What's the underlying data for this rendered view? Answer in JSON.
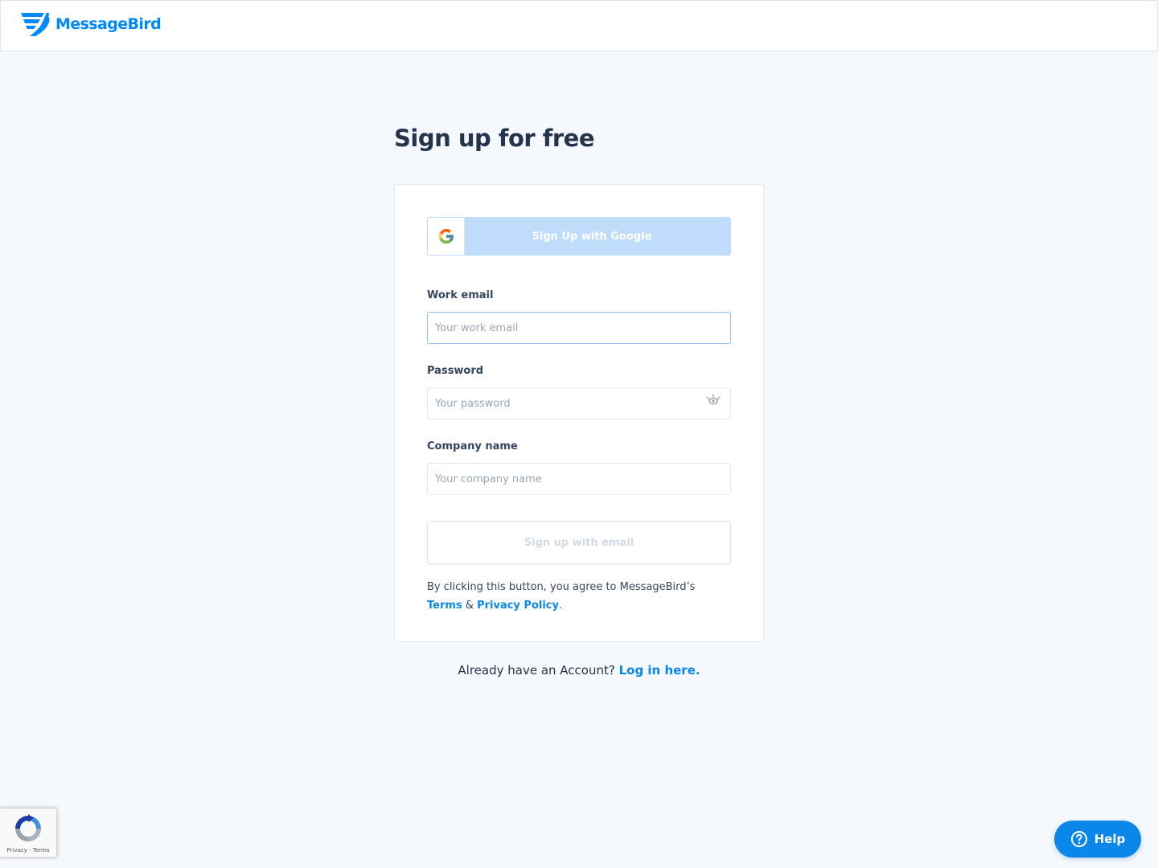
{
  "brand": {
    "name": "MessageBird",
    "color": "#0089ff",
    "logo_icon": "messagebird-logo-icon"
  },
  "page": {
    "title": "Sign up for free"
  },
  "google_button": {
    "label": "Sign Up with Google",
    "icon": "google-icon"
  },
  "form": {
    "email": {
      "label": "Work email",
      "placeholder": "Your work email",
      "value": ""
    },
    "password": {
      "label": "Password",
      "placeholder": "Your password",
      "value": "",
      "toggle_icon": "eye-icon"
    },
    "company": {
      "label": "Company name",
      "placeholder": "Your company name",
      "value": ""
    },
    "submit_label": "Sign up with email"
  },
  "legal": {
    "prefix": "By clicking this button, you agree to MessageBird’s",
    "terms_link": "Terms",
    "ampersand": "&",
    "privacy_link": "Privacy Policy",
    "suffix": "."
  },
  "login": {
    "prompt": "Already have an Account?",
    "link": "Log in here."
  },
  "recaptcha": {
    "privacy": "Privacy",
    "separator": "-",
    "terms": "Terms",
    "icon": "recaptcha-icon"
  },
  "help": {
    "label": "Help",
    "icon": "question-circle-icon"
  },
  "colors": {
    "accent": "#0a87e8",
    "background": "#f5f8fd",
    "google_button_bg": "#bfdcfb"
  }
}
